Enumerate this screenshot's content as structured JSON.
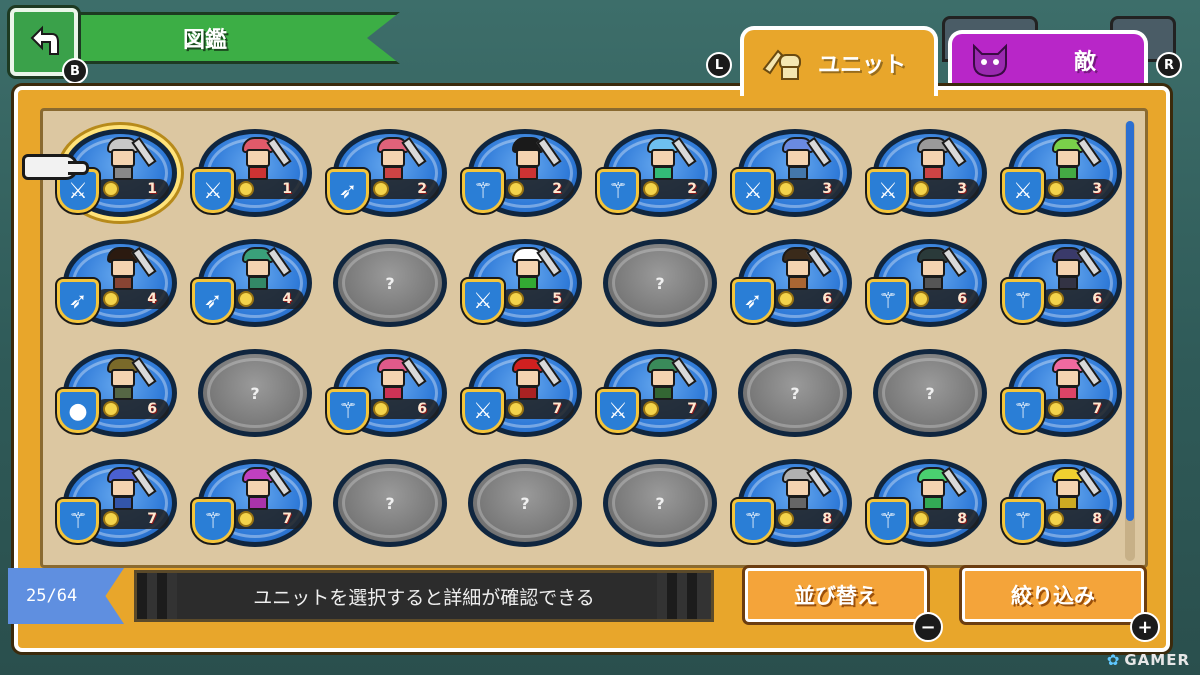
{
  "header": {
    "title": "図鑑",
    "back_hint": "B",
    "tab_left_hint": "L",
    "tab_right_hint": "R"
  },
  "tabs": [
    {
      "label": "ユニット",
      "icon": "unit-helmet-icon",
      "active": true,
      "color": "#e8a62b"
    },
    {
      "label": "敵",
      "icon": "enemy-demon-icon",
      "active": false,
      "color": "#b826c8"
    }
  ],
  "grid": {
    "selected_index": 0,
    "rows": [
      [
        {
          "cost": "1",
          "class": "sword",
          "hat": "#c8c8c8",
          "body": "#888"
        },
        {
          "cost": "1",
          "class": "sword",
          "hat": "#e05a6a",
          "body": "#c33"
        },
        {
          "cost": "2",
          "class": "bow",
          "hat": "#e0627a",
          "body": "#c44"
        },
        {
          "cost": "2",
          "class": "staff",
          "hat": "#1a1a1a",
          "body": "#c33"
        },
        {
          "cost": "2",
          "class": "staff",
          "hat": "#6ec0f0",
          "body": "#3b7"
        },
        {
          "cost": "3",
          "class": "sword",
          "hat": "#6a8ae0",
          "body": "#47a"
        },
        {
          "cost": "3",
          "class": "sword",
          "hat": "#9a9a9a",
          "body": "#c44"
        },
        {
          "cost": "3",
          "class": "sword",
          "hat": "#7ad04a",
          "body": "#4a4"
        }
      ],
      [
        {
          "cost": "4",
          "class": "bow",
          "hat": "#2b1a10",
          "body": "#843"
        },
        {
          "cost": "4",
          "class": "bow",
          "hat": "#3aa07a",
          "body": "#386"
        },
        {
          "locked": true,
          "label": "?"
        },
        {
          "cost": "5",
          "class": "sword",
          "hat": "#ffffff",
          "body": "#3a3"
        },
        {
          "locked": true,
          "label": "?"
        },
        {
          "cost": "6",
          "class": "bow",
          "hat": "#3a2a1a",
          "body": "#a63"
        },
        {
          "cost": "6",
          "class": "staff",
          "hat": "#2a3a3a",
          "body": "#555"
        },
        {
          "cost": "6",
          "class": "staff",
          "hat": "#3a3a6a",
          "body": "#334"
        }
      ],
      [
        {
          "cost": "6",
          "class": "orb",
          "hat": "#7a6a2a",
          "body": "#564"
        },
        {
          "locked": true,
          "label": "?"
        },
        {
          "cost": "6",
          "class": "staff",
          "hat": "#e05a8a",
          "body": "#c35"
        },
        {
          "cost": "7",
          "class": "sword",
          "hat": "#d02020",
          "body": "#a22"
        },
        {
          "cost": "7",
          "class": "sword",
          "hat": "#3a8a5a",
          "body": "#363"
        },
        {
          "locked": true,
          "label": "?"
        },
        {
          "locked": true,
          "label": "?"
        },
        {
          "cost": "7",
          "class": "staff",
          "hat": "#f06aa0",
          "body": "#d46"
        }
      ],
      [
        {
          "cost": "7",
          "class": "staff",
          "hat": "#4a60d0",
          "body": "#35a"
        },
        {
          "cost": "7",
          "class": "staff",
          "hat": "#c040c0",
          "body": "#a3a"
        },
        {
          "locked": true,
          "label": "?"
        },
        {
          "locked": true,
          "label": "?"
        },
        {
          "locked": true,
          "label": "?"
        },
        {
          "cost": "8",
          "class": "staff",
          "hat": "#b0b0b0",
          "body": "#666"
        },
        {
          "cost": "8",
          "class": "staff",
          "hat": "#4ad070",
          "body": "#3a5"
        },
        {
          "cost": "8",
          "class": "staff",
          "hat": "#f0d030",
          "body": "#ca2"
        }
      ]
    ]
  },
  "footer": {
    "counter": "25/64",
    "hint": "ユニットを選択すると詳細が確認できる",
    "sort_label": "並び替え",
    "sort_hint": "−",
    "filter_label": "絞り込み",
    "filter_hint": "+"
  },
  "watermark": "GAMER",
  "colors": {
    "panel": "#e8a62b",
    "medal": "#2f7ad8",
    "locked": "#7a7a7a"
  }
}
